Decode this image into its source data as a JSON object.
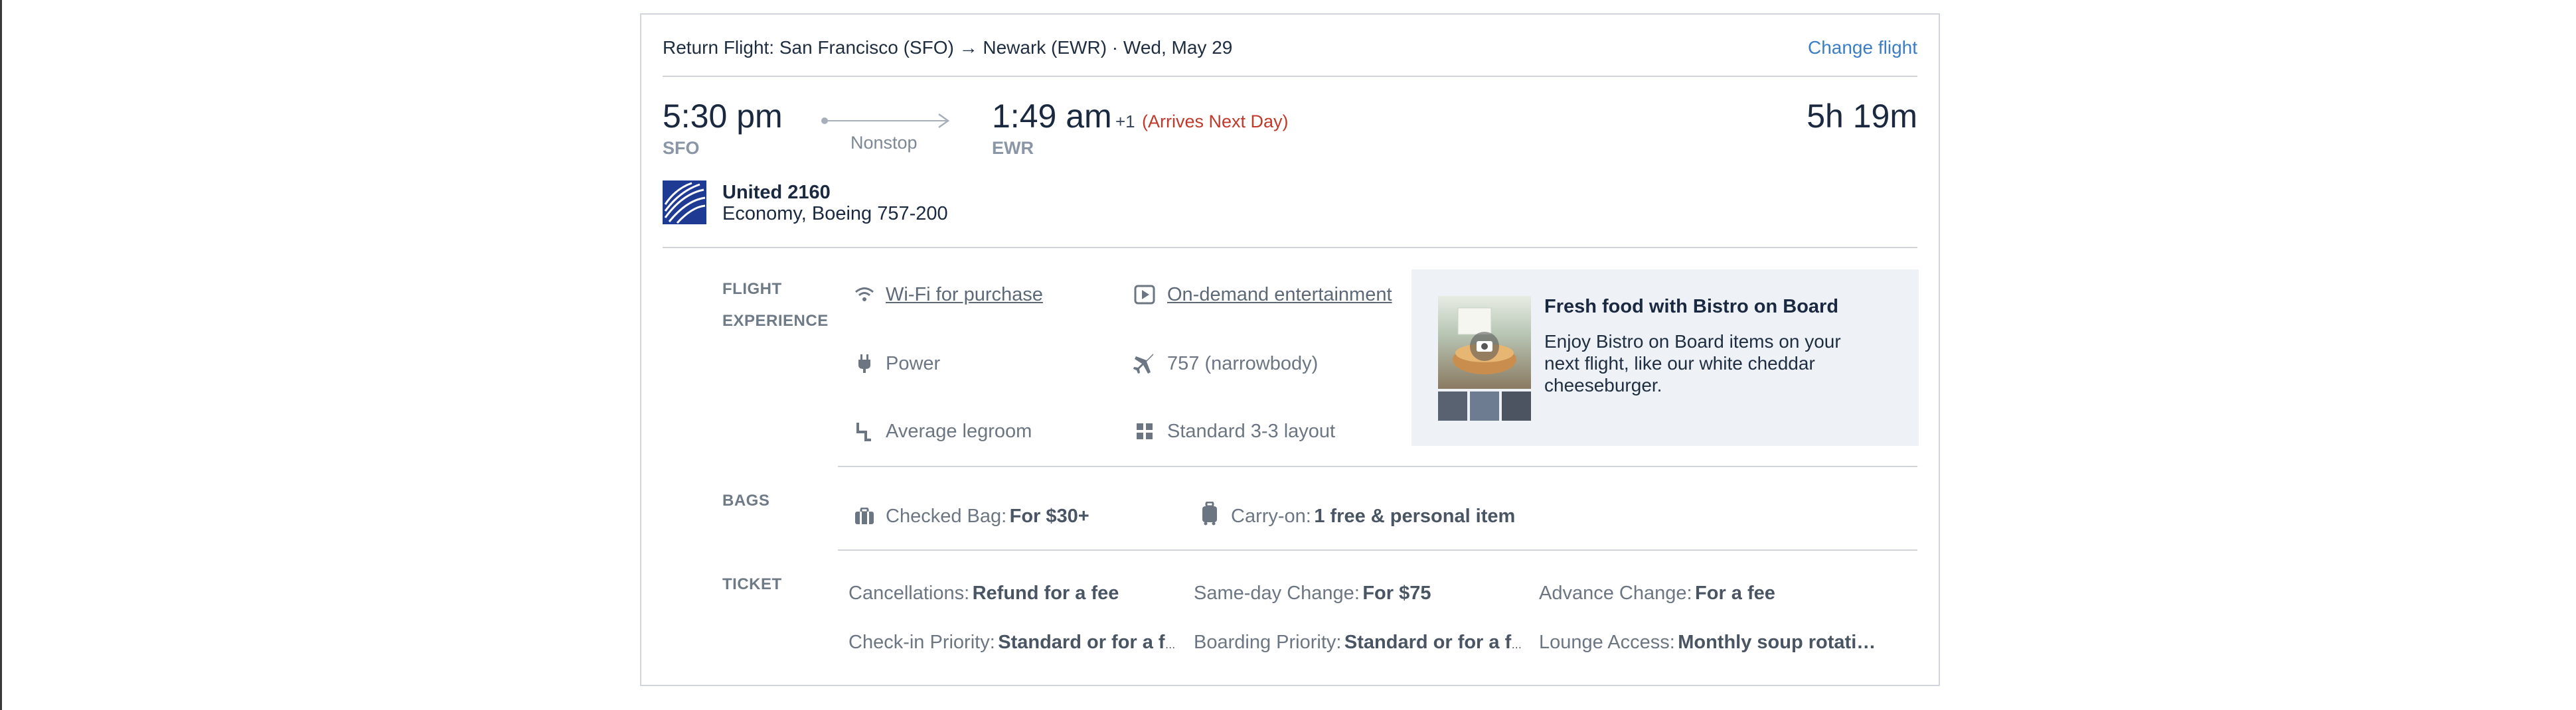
{
  "header": {
    "title": "Return Flight: San Francisco (SFO) → Newark (EWR) · Wed, May 29",
    "change_link": "Change flight"
  },
  "itinerary": {
    "depart_time": "5:30 pm",
    "depart_code": "SFO",
    "stops": "Nonstop",
    "arrive_time": "1:49 am",
    "day_offset": "+1",
    "arrive_note": "(Arrives Next Day)",
    "arrive_code": "EWR",
    "duration": "5h 19m",
    "flight_number": "United 2160",
    "cabin_aircraft": "Economy, Boeing 757-200"
  },
  "experience": {
    "label_line1": "FLIGHT",
    "label_line2": "EXPERIENCE",
    "items": [
      {
        "text": "Wi-Fi for purchase",
        "icon": "wifi-icon"
      },
      {
        "text": "On-demand entertainment",
        "icon": "play-icon"
      },
      {
        "text": "Power",
        "icon": "power-plug-icon"
      },
      {
        "text": "757 (narrowbody)",
        "icon": "airplane-icon"
      },
      {
        "text": "Average legroom",
        "icon": "seat-icon"
      },
      {
        "text": "Standard 3-3 layout",
        "icon": "grid-layout-icon"
      }
    ],
    "promo": {
      "title": "Fresh food with Bistro on Board",
      "text": "Enjoy Bistro on Board items on your next flight, like our white cheddar cheeseburger."
    }
  },
  "bags": {
    "label": "BAGS",
    "checked_key": "Checked Bag:",
    "checked_val": "For $30+",
    "carry_key": "Carry-on:",
    "carry_val": "1 free & personal item"
  },
  "ticket": {
    "label": "TICKET",
    "rows": [
      [
        {
          "key": "Cancellations:",
          "val": "Refund for a fee"
        },
        {
          "key": "Same-day Change:",
          "val": "For $75"
        },
        {
          "key": "Advance Change:",
          "val": "For a fee"
        }
      ],
      [
        {
          "key": "Check-in Priority:",
          "val": "Standard or for a f…"
        },
        {
          "key": "Boarding Priority:",
          "val": "Standard or for a f…"
        },
        {
          "key": "Lounge Access:",
          "val": "Monthly soup rotati…"
        }
      ]
    ]
  },
  "colors": {
    "link": "#3b7ec8",
    "arrives_next_day": "#c0392b",
    "united_logo": "#1f3a93",
    "promo_bg": "#eef2f7"
  }
}
